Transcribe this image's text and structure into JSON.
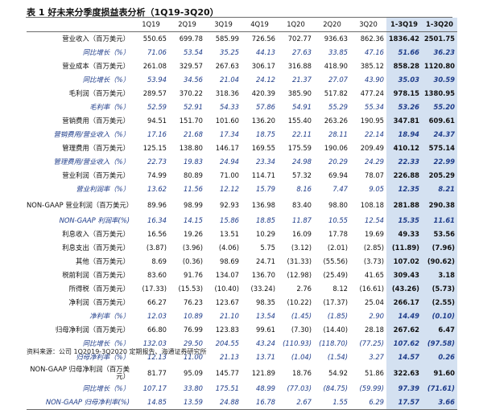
{
  "table_title": {
    "number": "表 1",
    "text": "好未来分季度损益表分析（1Q19-3Q20）"
  },
  "columns": [
    "1Q19",
    "2Q19",
    "3Q19",
    "4Q19",
    "1Q20",
    "2Q20",
    "3Q20",
    "1-3Q19",
    "1-3Q20"
  ],
  "rows": [
    {
      "label": "营业收入（百万美元）",
      "values": [
        "550.65",
        "699.78",
        "585.99",
        "726.56",
        "702.77",
        "936.63",
        "862.36",
        "1836.42",
        "2501.75"
      ],
      "italic": false
    },
    {
      "label": "同比增长（%）",
      "values": [
        "71.06",
        "53.54",
        "35.25",
        "44.13",
        "27.63",
        "33.85",
        "47.16",
        "51.66",
        "36.23"
      ],
      "italic": true
    },
    {
      "label": "营业成本（百万美元）",
      "values": [
        "261.08",
        "329.57",
        "267.63",
        "306.17",
        "316.88",
        "418.90",
        "385.12",
        "858.28",
        "1120.80"
      ],
      "italic": false
    },
    {
      "label": "同比增长（%）",
      "values": [
        "53.94",
        "34.56",
        "21.04",
        "24.12",
        "21.37",
        "27.07",
        "43.90",
        "35.03",
        "30.59"
      ],
      "italic": true
    },
    {
      "label": "毛利润（百万美元）",
      "values": [
        "289.57",
        "370.22",
        "318.36",
        "420.39",
        "385.90",
        "517.82",
        "477.24",
        "978.15",
        "1380.95"
      ],
      "italic": false
    },
    {
      "label": "毛利率（%）",
      "values": [
        "52.59",
        "52.91",
        "54.33",
        "57.86",
        "54.91",
        "55.29",
        "55.34",
        "53.26",
        "55.20"
      ],
      "italic": true
    },
    {
      "label": "营销费用（百万美元）",
      "values": [
        "94.51",
        "151.70",
        "101.60",
        "136.20",
        "155.40",
        "263.26",
        "190.95",
        "347.81",
        "609.61"
      ],
      "italic": false
    },
    {
      "label": "营销费用/营业收入（%）",
      "values": [
        "17.16",
        "21.68",
        "17.34",
        "18.75",
        "22.11",
        "28.11",
        "22.14",
        "18.94",
        "24.37"
      ],
      "italic": true
    },
    {
      "label": "管理费用（百万美元）",
      "values": [
        "125.15",
        "138.80",
        "146.17",
        "169.55",
        "175.59",
        "190.06",
        "209.49",
        "410.12",
        "575.14"
      ],
      "italic": false
    },
    {
      "label": "管理费用/营业收入（%）",
      "values": [
        "22.73",
        "19.83",
        "24.94",
        "23.34",
        "24.98",
        "20.29",
        "24.29",
        "22.33",
        "22.99"
      ],
      "italic": true
    },
    {
      "label": "营业利润（百万美元）",
      "values": [
        "74.99",
        "80.89",
        "71.00",
        "114.71",
        "57.32",
        "69.94",
        "78.07",
        "226.88",
        "205.29"
      ],
      "italic": false
    },
    {
      "label": "营业利润率（%）",
      "values": [
        "13.62",
        "11.56",
        "12.12",
        "15.79",
        "8.16",
        "7.47",
        "9.05",
        "12.35",
        "8.21"
      ],
      "italic": true
    },
    {
      "label": "NON-GAAP 营业利润（百万美元）",
      "values": [
        "89.96",
        "98.99",
        "92.93",
        "136.98",
        "83.40",
        "98.80",
        "108.18",
        "281.88",
        "290.38"
      ],
      "italic": false,
      "tall": true
    },
    {
      "label": "NON-GAAP 利润率(%)",
      "values": [
        "16.34",
        "14.15",
        "15.86",
        "18.85",
        "11.87",
        "10.55",
        "12.54",
        "15.35",
        "11.61"
      ],
      "italic": true
    },
    {
      "label": "利息收入（百万美元）",
      "values": [
        "16.56",
        "19.26",
        "13.51",
        "10.29",
        "16.09",
        "17.78",
        "19.69",
        "49.33",
        "53.56"
      ],
      "italic": false
    },
    {
      "label": "利息支出（百万美元）",
      "values": [
        "(3.87)",
        "(3.96)",
        "(4.06)",
        "5.75",
        "(3.12)",
        "(2.01)",
        "(2.85)",
        "(11.89)",
        "(7.96)"
      ],
      "italic": false
    },
    {
      "label": "其他（百万美元）",
      "values": [
        "8.69",
        "(0.36)",
        "98.69",
        "24.71",
        "(31.33)",
        "(55.56)",
        "(3.73)",
        "107.02",
        "(90.62)"
      ],
      "italic": false
    },
    {
      "label": "税前利润（百万美元）",
      "values": [
        "83.60",
        "91.76",
        "134.07",
        "136.70",
        "(12.98)",
        "(25.49)",
        "41.65",
        "309.43",
        "3.18"
      ],
      "italic": false
    },
    {
      "label": "所得税（百万美元）",
      "values": [
        "(17.33)",
        "(15.53)",
        "(10.40)",
        "(33.24)",
        "2.76",
        "8.12",
        "(16.61)",
        "(43.26)",
        "(5.73)"
      ],
      "italic": false
    },
    {
      "label": "净利润（百万美元）",
      "values": [
        "66.27",
        "76.23",
        "123.67",
        "98.35",
        "(10.22)",
        "(17.37)",
        "25.04",
        "266.17",
        "(2.55)"
      ],
      "italic": false
    },
    {
      "label": "净利率（%）",
      "values": [
        "12.03",
        "10.89",
        "21.10",
        "13.54",
        "(1.45)",
        "(1.85)",
        "2.90",
        "14.49",
        "(0.10)"
      ],
      "italic": true
    },
    {
      "label": "归母净利润（百万美元）",
      "values": [
        "66.80",
        "76.99",
        "123.83",
        "99.61",
        "(7.30)",
        "(14.40)",
        "28.18",
        "267.62",
        "6.47"
      ],
      "italic": false
    },
    {
      "label": "同比增长（%）",
      "values": [
        "132.03",
        "29.50",
        "204.55",
        "43.24",
        "(110.93)",
        "(118.70)",
        "(77.25)",
        "107.62",
        "(97.58)"
      ],
      "italic": true
    },
    {
      "label": "归母净利率（%）",
      "values": [
        "12.13",
        "11.00",
        "21.13",
        "13.71",
        "(1.04)",
        "(1.54)",
        "3.27",
        "14.57",
        "0.26"
      ],
      "italic": true
    },
    {
      "label": "NON-GAAP 归母净利润（百万美元）",
      "values": [
        "81.77",
        "95.09",
        "145.77",
        "121.89",
        "18.76",
        "54.92",
        "51.86",
        "322.63",
        "91.60"
      ],
      "italic": false,
      "tall": true
    },
    {
      "label": "同比增长（%）",
      "values": [
        "107.17",
        "33.80",
        "175.51",
        "48.99",
        "(77.03)",
        "(84.75)",
        "(59.99)",
        "97.39",
        "(71.61)"
      ],
      "italic": true
    },
    {
      "label": "NON-GAAP 归母净利率(%)",
      "values": [
        "14.85",
        "13.59",
        "24.88",
        "16.78",
        "2.67",
        "1.55",
        "6.29",
        "17.57",
        "3.66"
      ],
      "italic": true
    }
  ],
  "source_note": "资料来源：公司 1Q2019-3Q2020 定期报告、海通证券研究所",
  "colors": {
    "highlight": "#d4e1f1",
    "italic_text": "#1f3d8a"
  }
}
